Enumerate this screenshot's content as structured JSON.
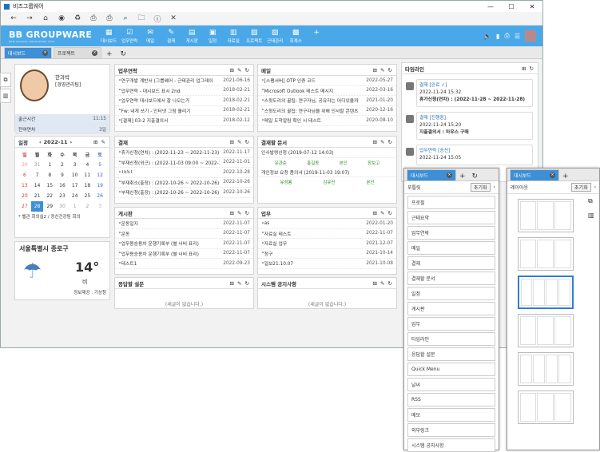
{
  "window": {
    "title": "비즈그룹웨어",
    "controls": [
      "—",
      "☐",
      "✕"
    ]
  },
  "toolbar_icons": [
    "←",
    "→",
    "⌂",
    "◉",
    "♻",
    "⎙",
    "⎙",
    "⌕",
    "🗀",
    "ⓘ",
    "✕"
  ],
  "brand": {
    "name": "BB GROUPWARE",
    "tagline": "NEW NORMAL SMARTWORK TOOL"
  },
  "menu": [
    {
      "icon": "▦",
      "label": "대시보드"
    },
    {
      "icon": "☑",
      "label": "업무연락"
    },
    {
      "icon": "✉",
      "label": "메일"
    },
    {
      "icon": "✎",
      "label": "결재"
    },
    {
      "icon": "▤",
      "label": "게시판"
    },
    {
      "icon": "▣",
      "label": "일정"
    },
    {
      "icon": "▥",
      "label": "자료실"
    },
    {
      "icon": "▧",
      "label": "프로젝트"
    },
    {
      "icon": "▨",
      "label": "근태관리"
    },
    {
      "icon": "▩",
      "label": "회계스"
    },
    {
      "icon": "+",
      "label": ""
    }
  ],
  "header_icons": [
    "🔈",
    "▮",
    "⎙",
    "☰"
  ],
  "tabs": [
    {
      "label": "대시보드",
      "active": true
    },
    {
      "label": "프로젝트",
      "active": false
    }
  ],
  "profile": {
    "name": "한과박",
    "dept": "[경영관리팀]",
    "stats": [
      {
        "k": "출근시간",
        "v": "11:15"
      },
      {
        "k": "잔여연차",
        "v": "3일"
      }
    ]
  },
  "calendar": {
    "title": "일정",
    "month": "2022-11",
    "days": [
      "일",
      "월",
      "화",
      "수",
      "목",
      "금",
      "토"
    ],
    "weeks": [
      [
        "30",
        "31",
        "1",
        "2",
        "3",
        "4",
        "5"
      ],
      [
        "6",
        "7",
        "8",
        "9",
        "10",
        "11",
        "12"
      ],
      [
        "13",
        "14",
        "15",
        "16",
        "17",
        "18",
        "19"
      ],
      [
        "20",
        "21",
        "22",
        "23",
        "24",
        "25",
        "26"
      ],
      [
        "27",
        "28",
        "29",
        "30",
        "1",
        "2",
        "3"
      ]
    ],
    "today": "28",
    "events": [
      "* 벨관 회의실2 / 정신건강팀 회의"
    ]
  },
  "weather": {
    "title": "서울특별시 종로구",
    "temp": "14°",
    "desc": "비",
    "source": "정보제공 : 기상청"
  },
  "work": {
    "title": "업무연락",
    "rows": [
      [
        "연구개발 계반서 (그룹웨어 - 근태관리 업그레이",
        "2021-06-16"
      ],
      [
        "업무연락 - 대시보드 표시 2nd",
        "2018-02-21"
      ],
      [
        "업무연락 대시보드에서 잘 나오는가",
        "2018-02-21"
      ],
      [
        "Fw: 내게 쓰기 - 인터넷 그림 올리기",
        "2018-02-21"
      ],
      [
        "[결재] 03-2 지출결의서",
        "2018-02-12"
      ]
    ]
  },
  "mail": {
    "title": "메일",
    "rows": [
      [
        "[스팸서버] OTP 인증 코드",
        "2022-05-27"
      ],
      [
        "Microsoft Outlook 테스트 메시지",
        "2022-03-16"
      ],
      [
        "스윗도리의 꿀팁: 연구자님, 공유자는 어디있을까",
        "2021-01-20"
      ],
      [
        "스윗도리의 꿀팁: 연구자님을 위해 인사말 콘텐츠",
        "2020-12-16"
      ],
      [
        "메일 도착알림 확인 시 테스트",
        "2020-08-10"
      ]
    ]
  },
  "approval": {
    "title": "결재",
    "rows": [
      [
        "휴가신청(연차) : (2022-11-23 ~ 2022-11-23)",
        "2022-11-17"
      ],
      [
        "부재신청(외근) : (2022-11-03 09:00 ~ 2022-11-03",
        "2022-11-01"
      ],
      [
        "TEST",
        "2022-10-28"
      ],
      [
        "부재취소(출장) : (2022-10-26 ~ 2022-10-26)",
        "2022-10-26"
      ],
      [
        "부재신청(출장) : (2022-10-26 ~ 2022-10-26)",
        "2022-10-26"
      ]
    ]
  },
  "docs": {
    "title": "결재할 문서",
    "items": [
      {
        "label": "인사발령신청 (2019-07-12 14:03)",
        "steps": [
          "유관순",
          "홍길동",
          "본인",
          "장보고"
        ]
      },
      {
        "label": "개인정보 요청 품의서 (2019-11-03 19:07)",
        "steps": [
          "유성룡",
          "김유신",
          "본인"
        ]
      }
    ]
  },
  "board": {
    "title": "게시판",
    "rows": [
      [
        "운동일지",
        "2022-11-07"
      ],
      [
        "운동",
        "2022-11-07"
      ],
      [
        "업무용승용차 운행기록부 (별 너비 표리)",
        "2022-11-07"
      ],
      [
        "업무용승용차 운행기록부 (별 너비 표리)",
        "2022-11-07"
      ],
      [
        "테스트1",
        "2022-09-23"
      ]
    ]
  },
  "task": {
    "title": "업무",
    "rows": [
      [
        "as",
        "2022-01-20"
      ],
      [
        "자료실 테스트",
        "2022-11-07"
      ],
      [
        "자료실 업무",
        "2021-12-07"
      ],
      [
        "청구",
        "2021-10-14"
      ],
      [
        "일보21.10.07",
        "2021-10-08"
      ]
    ]
  },
  "survey": {
    "title": "응답할 설문",
    "empty": "(새글이 없습니다.)"
  },
  "notice": {
    "title": "시스템 공지사항",
    "empty": "(새글이 없습니다.)"
  },
  "timeline": {
    "title": "타임라인",
    "items": [
      {
        "title": "결재 [완료 ✓]",
        "date": "2022-11-24 15:32",
        "body": "휴가신청(연차) : (2022-11-28 ~ 2022-11-28)"
      },
      {
        "title": "결재 [진행중]",
        "date": "2022-11-24 15:20",
        "body": "지출결의서 : 마우스 구매"
      },
      {
        "title": "업무연락 [송신]",
        "date": "2022-11-24 15:05",
        "body": ""
      }
    ]
  },
  "portlet_panel": {
    "tab": "대시보드",
    "heading": "포틀릿",
    "reset": "초기화",
    "items": [
      "프로필",
      "근태요약",
      "업무연락",
      "메일",
      "결재",
      "결재할 문서",
      "일정",
      "게시판",
      "업무",
      "타임라인",
      "응답할 설문",
      "Quick Menu",
      "날씨",
      "RSS",
      "메모",
      "외부링크",
      "시스템 공지사항"
    ]
  },
  "layout_panel": {
    "tab": "대시보드",
    "heading": "레이아웃",
    "reset": "초기화"
  }
}
